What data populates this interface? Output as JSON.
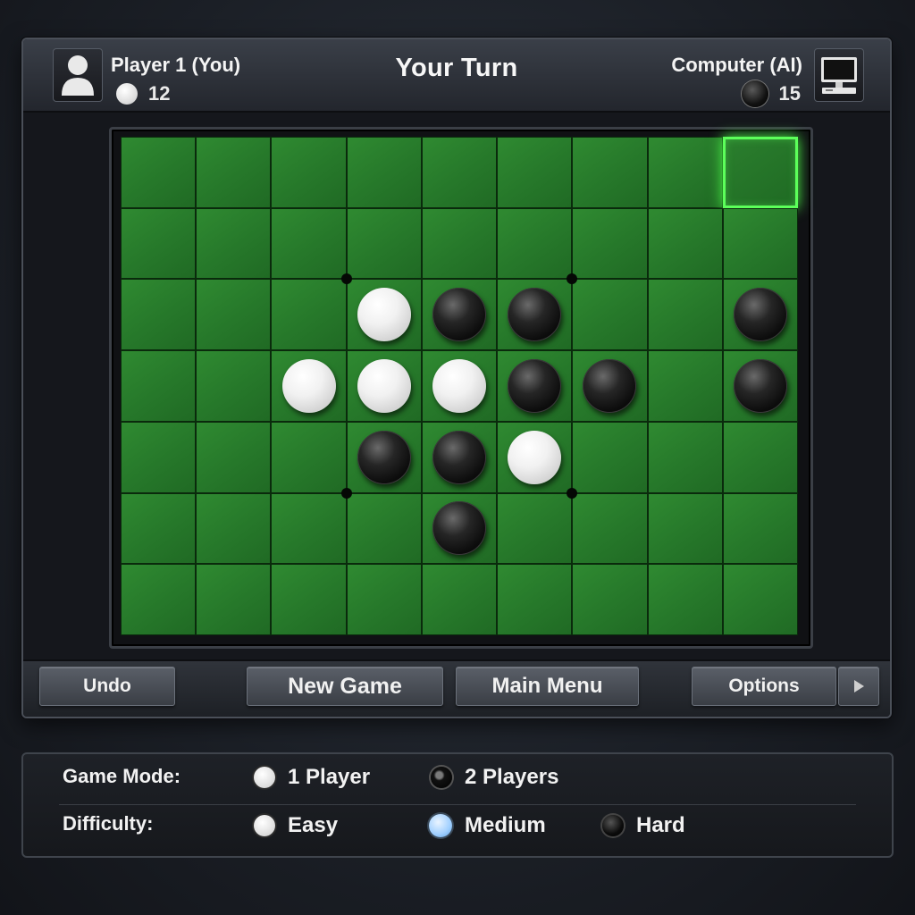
{
  "header": {
    "player_name": "Player 1 (You)",
    "player_score": "12",
    "turn_title": "Your Turn",
    "computer_name": "Computer (AI)",
    "computer_score": "15"
  },
  "board": {
    "rows": 7,
    "cols": 9,
    "highlight": [
      0,
      8
    ],
    "discs": [
      {
        "r": 2,
        "c": 3,
        "color": "white"
      },
      {
        "r": 2,
        "c": 4,
        "color": "black"
      },
      {
        "r": 2,
        "c": 5,
        "color": "black"
      },
      {
        "r": 2,
        "c": 8,
        "color": "black"
      },
      {
        "r": 3,
        "c": 2,
        "color": "white"
      },
      {
        "r": 3,
        "c": 3,
        "color": "white"
      },
      {
        "r": 3,
        "c": 4,
        "color": "white"
      },
      {
        "r": 3,
        "c": 5,
        "color": "black"
      },
      {
        "r": 3,
        "c": 6,
        "color": "black"
      },
      {
        "r": 3,
        "c": 8,
        "color": "black"
      },
      {
        "r": 4,
        "c": 3,
        "color": "black"
      },
      {
        "r": 4,
        "c": 4,
        "color": "black"
      },
      {
        "r": 4,
        "c": 5,
        "color": "white"
      },
      {
        "r": 5,
        "c": 4,
        "color": "black"
      }
    ],
    "star_points": [
      [
        2,
        3
      ],
      [
        2,
        6
      ],
      [
        5,
        3
      ],
      [
        5,
        6
      ]
    ],
    "highlight_color": "#5cff5a",
    "board_color": "#2f8a31"
  },
  "toolbar": {
    "undo_label": "Undo",
    "new_game_label": "New Game",
    "main_menu_label": "Main Menu",
    "options_label": "Options",
    "arrow_icon": "play-arrow-icon"
  },
  "settings": {
    "game_mode_label": "Game Mode:",
    "difficulty_label": "Difficulty:",
    "mode_options": [
      "1 Player",
      "2 Players"
    ],
    "mode_selected": "2 Players",
    "difficulty_options": [
      "Easy",
      "Medium",
      "Hard"
    ],
    "difficulty_selected": "Medium"
  }
}
